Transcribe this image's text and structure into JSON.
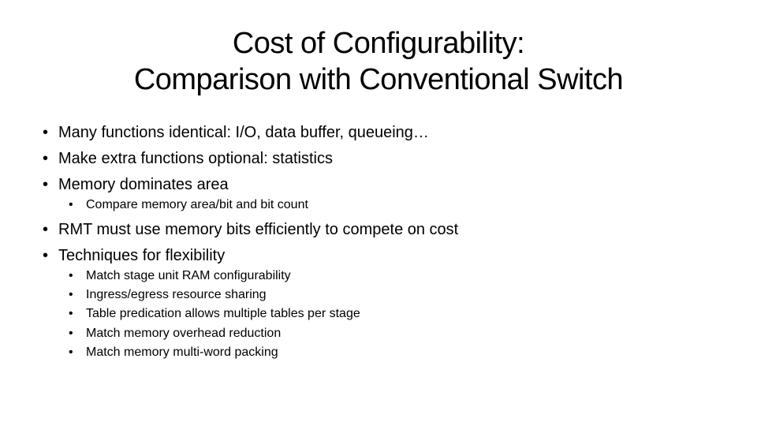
{
  "slide": {
    "title_lines": [
      "Cost of Configurability:",
      "Comparison with Conventional Switch"
    ],
    "bullet_glyph": "•",
    "bullets": [
      {
        "level": 1,
        "text": "Many functions identical:  I/O, data buffer, queueing…"
      },
      {
        "level": 1,
        "text": "Make extra functions optional: statistics"
      },
      {
        "level": 1,
        "text": "Memory dominates area"
      },
      {
        "level": 2,
        "text": "Compare memory area/bit and bit count"
      },
      {
        "level": 1,
        "text": "RMT must use memory bits efficiently to compete on cost"
      },
      {
        "level": 1,
        "text": "Techniques for flexibility"
      },
      {
        "level": 2,
        "text": "Match stage unit RAM configurability"
      },
      {
        "level": 2,
        "text": "Ingress/egress resource sharing"
      },
      {
        "level": 2,
        "text": "Table predication allows multiple tables per stage"
      },
      {
        "level": 2,
        "text": "Match memory overhead reduction"
      },
      {
        "level": 2,
        "text": "Match memory multi-word packing"
      }
    ]
  }
}
